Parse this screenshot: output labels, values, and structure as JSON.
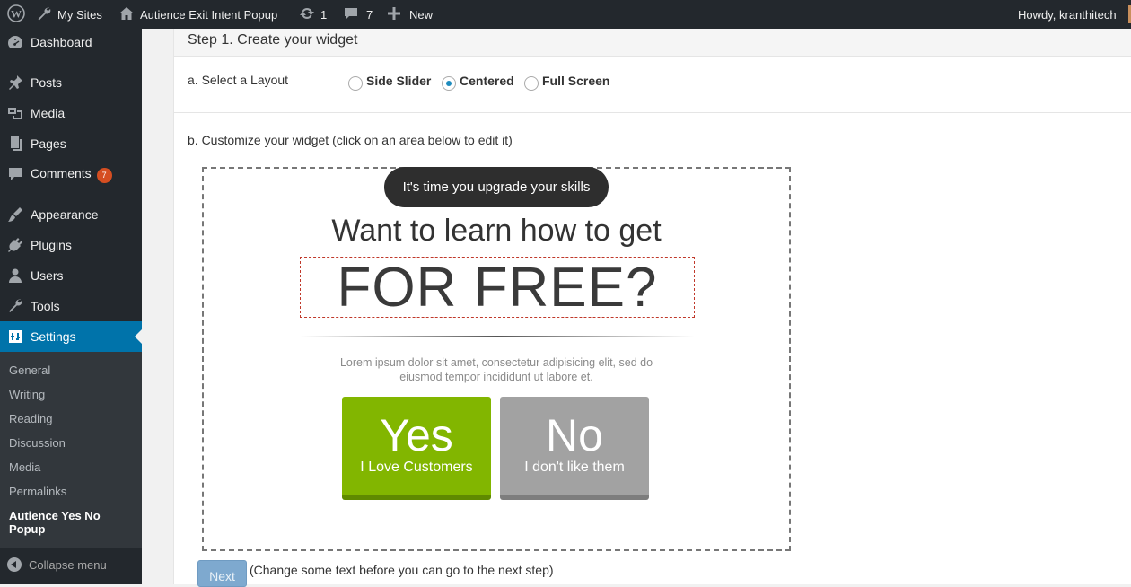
{
  "admin_bar": {
    "my_sites": "My Sites",
    "site_name": "Autience Exit Intent Popup",
    "updates_count": "1",
    "comments_count": "7",
    "new_label": "New",
    "greeting": "Howdy, kranthitech"
  },
  "sidebar": {
    "dashboard": "Dashboard",
    "posts": "Posts",
    "media": "Media",
    "pages": "Pages",
    "comments": "Comments",
    "comments_badge": "7",
    "appearance": "Appearance",
    "plugins": "Plugins",
    "users": "Users",
    "tools": "Tools",
    "settings": "Settings",
    "submenu": [
      "General",
      "Writing",
      "Reading",
      "Discussion",
      "Media",
      "Permalinks"
    ],
    "submenu_current": "Autience Yes No Popup",
    "collapse": "Collapse menu"
  },
  "main": {
    "step_title": "Step 1. Create your widget",
    "layout_label": "a. Select a Layout",
    "layout_options": [
      "Side Slider",
      "Centered",
      "Full Screen"
    ],
    "layout_selected": "Centered",
    "customize_label": "b. Customize your widget (click on an area below to edit it)"
  },
  "widget": {
    "pill_text": "It's time you upgrade your skills",
    "headline": "Want to learn how to get",
    "big_text": "FOR FREE?",
    "lorem": "Lorem ipsum dolor sit amet, consectetur adipisicing elit, sed do eiusmod tempor incididunt ut labore et.",
    "yes_main": "Yes",
    "yes_sub": "I Love Customers",
    "no_main": "No",
    "no_sub": "I don't like them",
    "yes_color": "#82b600",
    "no_color": "#a2a2a2"
  },
  "footer": {
    "next_label": "Next",
    "next_note": "(Change some text before you can go to the next step)"
  },
  "icons": [
    "wordpress-icon",
    "wrench-icon",
    "home-icon",
    "refresh-icon",
    "comment-icon",
    "plus-icon",
    "dashboard-icon",
    "pin-icon",
    "media-icon",
    "pages-icon",
    "appearance-icon",
    "plugins-icon",
    "users-icon",
    "tools-icon",
    "settings-icon",
    "collapse-icon"
  ]
}
